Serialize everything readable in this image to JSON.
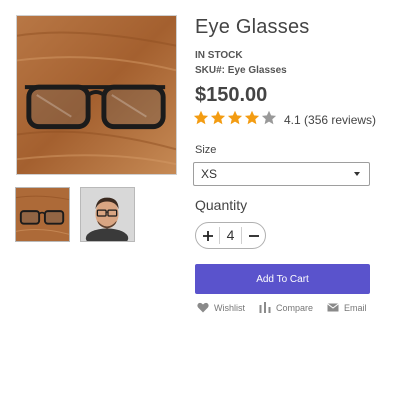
{
  "product": {
    "title": "Eye Glasses",
    "stock_status": "IN STOCK",
    "sku_label": "SKU#:",
    "sku_value": "Eye Glasses",
    "price": "$150.00",
    "rating": {
      "stars_filled": 4,
      "stars_total": 5,
      "value": "4.1",
      "reviews": "(356 reviews)",
      "star_color": "#f39c12",
      "star_empty_color": "#999999"
    }
  },
  "gallery": {
    "main_image_icon": "glasses-on-wood-image",
    "thumbnails": [
      {
        "icon": "glasses-on-wood-thumbnail",
        "selected": true
      },
      {
        "icon": "man-with-glasses-thumbnail",
        "selected": false
      }
    ]
  },
  "options": {
    "size_label": "Size",
    "size_selected": "XS",
    "quantity_label": "Quantity",
    "quantity_value": "4"
  },
  "buttons": {
    "add_to_cart": "Add To Cart",
    "add_to_cart_color": "#5a53cc"
  },
  "actions": [
    {
      "label": "Wishlist",
      "icon": "heart-icon"
    },
    {
      "label": "Compare",
      "icon": "bar-chart-icon"
    },
    {
      "label": "Email",
      "icon": "envelope-icon"
    }
  ]
}
